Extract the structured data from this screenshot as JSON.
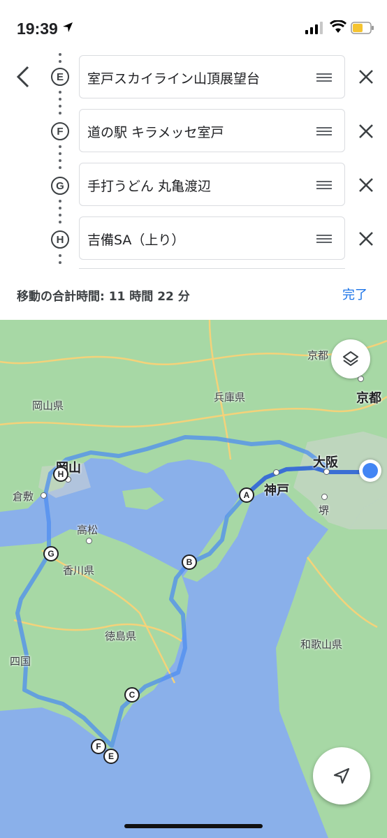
{
  "status_bar": {
    "time": "19:39"
  },
  "waypoints": [
    {
      "letter": "E",
      "name": "室戸スカイライン山頂展望台"
    },
    {
      "letter": "F",
      "name": "道の駅 キラメッセ室戸"
    },
    {
      "letter": "G",
      "name": "手打うどん 丸亀渡辺"
    },
    {
      "letter": "H",
      "name": "吉備SA（上り）"
    }
  ],
  "summary": {
    "total_time": "移動の合計時間: 11 時間 22 分",
    "done_label": "完了"
  },
  "map": {
    "labels": {
      "okayama_pref": "岡山県",
      "hyogo_pref": "兵庫県",
      "kyoto_small": "京都",
      "kyoto_city": "京都",
      "okayama_city": "岡山",
      "kurashiki": "倉敷",
      "osaka": "大阪",
      "kobe": "神戸",
      "sakai": "堺",
      "takamatsu": "高松",
      "kagawa_pref": "香川県",
      "tokushima_pref": "徳島県",
      "wakayama_pref": "和歌山県",
      "shikoku": "四国"
    },
    "markers": [
      "A",
      "B",
      "C",
      "E",
      "F",
      "G",
      "H"
    ],
    "colors": {
      "route": "#4d8ef0",
      "land": "#a7d8a5",
      "sea": "#8ab0ea"
    }
  }
}
